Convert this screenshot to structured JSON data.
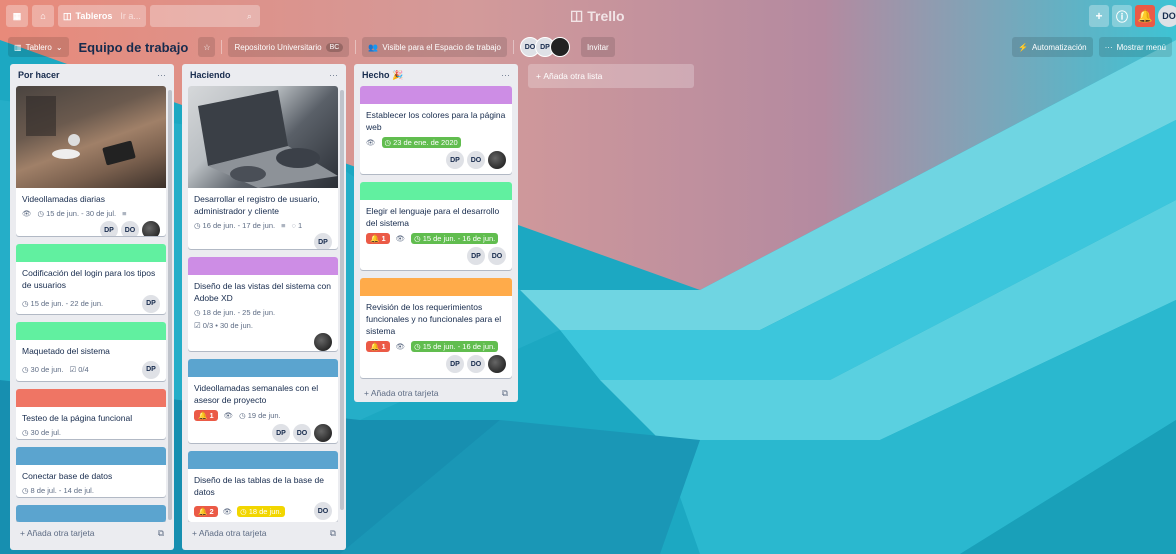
{
  "nav": {
    "boards_label": "Tableros",
    "search_placeholder": "Ir a...",
    "logo": "Trello",
    "user_initials": "DO"
  },
  "board": {
    "view_label": "Tablero",
    "title": "Equipo de trabajo",
    "team_label": "Repositorio Universitario",
    "team_badge": "BC",
    "visibility": "Visible para el Espacio de trabajo",
    "members": [
      "DO",
      "DP"
    ],
    "invite": "Invitar",
    "automation": "Automatización",
    "menu": "Mostrar menú"
  },
  "lists": [
    {
      "title": "Por hacer",
      "add_card": "Añada otra tarjeta",
      "cards": [
        {
          "title": "Videollamadas diarias",
          "cover": "image",
          "watch": true,
          "due": "15 de jun. - 30 de jul.",
          "description": true,
          "members": [
            "DP",
            "DO",
            "photo"
          ]
        },
        {
          "title": "Codificación del login para los tipos de usuarios",
          "cover": "#61f0a0",
          "due": "15 de jun. - 22 de jun.",
          "members": [
            "DP"
          ]
        },
        {
          "title": "Maquetado del sistema",
          "cover": "#61f0a0",
          "due": "30 de jun.",
          "checklist": "0/4",
          "members": [
            "DP"
          ]
        },
        {
          "title": "Testeo de la página funcional",
          "cover": "#ef7564",
          "due": "30 de jul.",
          "members": []
        },
        {
          "title": "Conectar base de datos",
          "cover": "#5ba4cf",
          "due": "8 de jul. - 14 de jul.",
          "members": []
        }
      ]
    },
    {
      "title": "Haciendo",
      "add_card": "Añada otra tarjeta",
      "cards": [
        {
          "title": "Desarrollar el registro de usuario, administrador y cliente",
          "cover": "image",
          "due": "16 de jun. - 17 de jun.",
          "description": true,
          "comments": "1",
          "members": [
            "DP"
          ]
        },
        {
          "title": "Diseño de las vistas del sistema con Adobe XD",
          "cover": "#cd8de5",
          "due": "18 de jun. - 25 de jun.",
          "checklist": "0/3 • 30 de jun.",
          "members": [
            "photo"
          ]
        },
        {
          "title": "Videollamadas semanales con el asesor de proyecto",
          "cover": "#5ba4cf",
          "count": "1",
          "watch": true,
          "due": "19 de jun.",
          "members": [
            "DP",
            "DO",
            "photo"
          ]
        },
        {
          "title": "Diseño de las tablas de la base de datos",
          "cover": "#5ba4cf",
          "count": "2",
          "watch": true,
          "due": "18 de jun.",
          "due_style": "yellow",
          "members": [
            "DO"
          ]
        }
      ]
    },
    {
      "title": "Hecho",
      "title_emoji": "🎉",
      "add_card": "Añada otra tarjeta",
      "cards": [
        {
          "title": "Establecer los colores para la página web",
          "cover": "#cd8de5",
          "watch": true,
          "due": "23 de ene. de 2020",
          "due_style": "green",
          "members": [
            "DP",
            "DO",
            "photo"
          ]
        },
        {
          "title": "Elegir el lenguaje para el desarrollo del sistema",
          "cover": "#61f0a0",
          "count": "1",
          "watch": true,
          "due": "15 de jun. - 16 de jun.",
          "due_style": "green",
          "members": [
            "DP",
            "DO"
          ]
        },
        {
          "title": "Revisión de los requerimientos funcionales y no funcionales para el sistema",
          "cover": "#ffab4a",
          "count": "1",
          "watch": true,
          "due": "15 de jun. - 16 de jun.",
          "due_style": "green",
          "members": [
            "DP",
            "DO",
            "photo"
          ]
        }
      ]
    }
  ],
  "add_list": "Añada otra lista"
}
